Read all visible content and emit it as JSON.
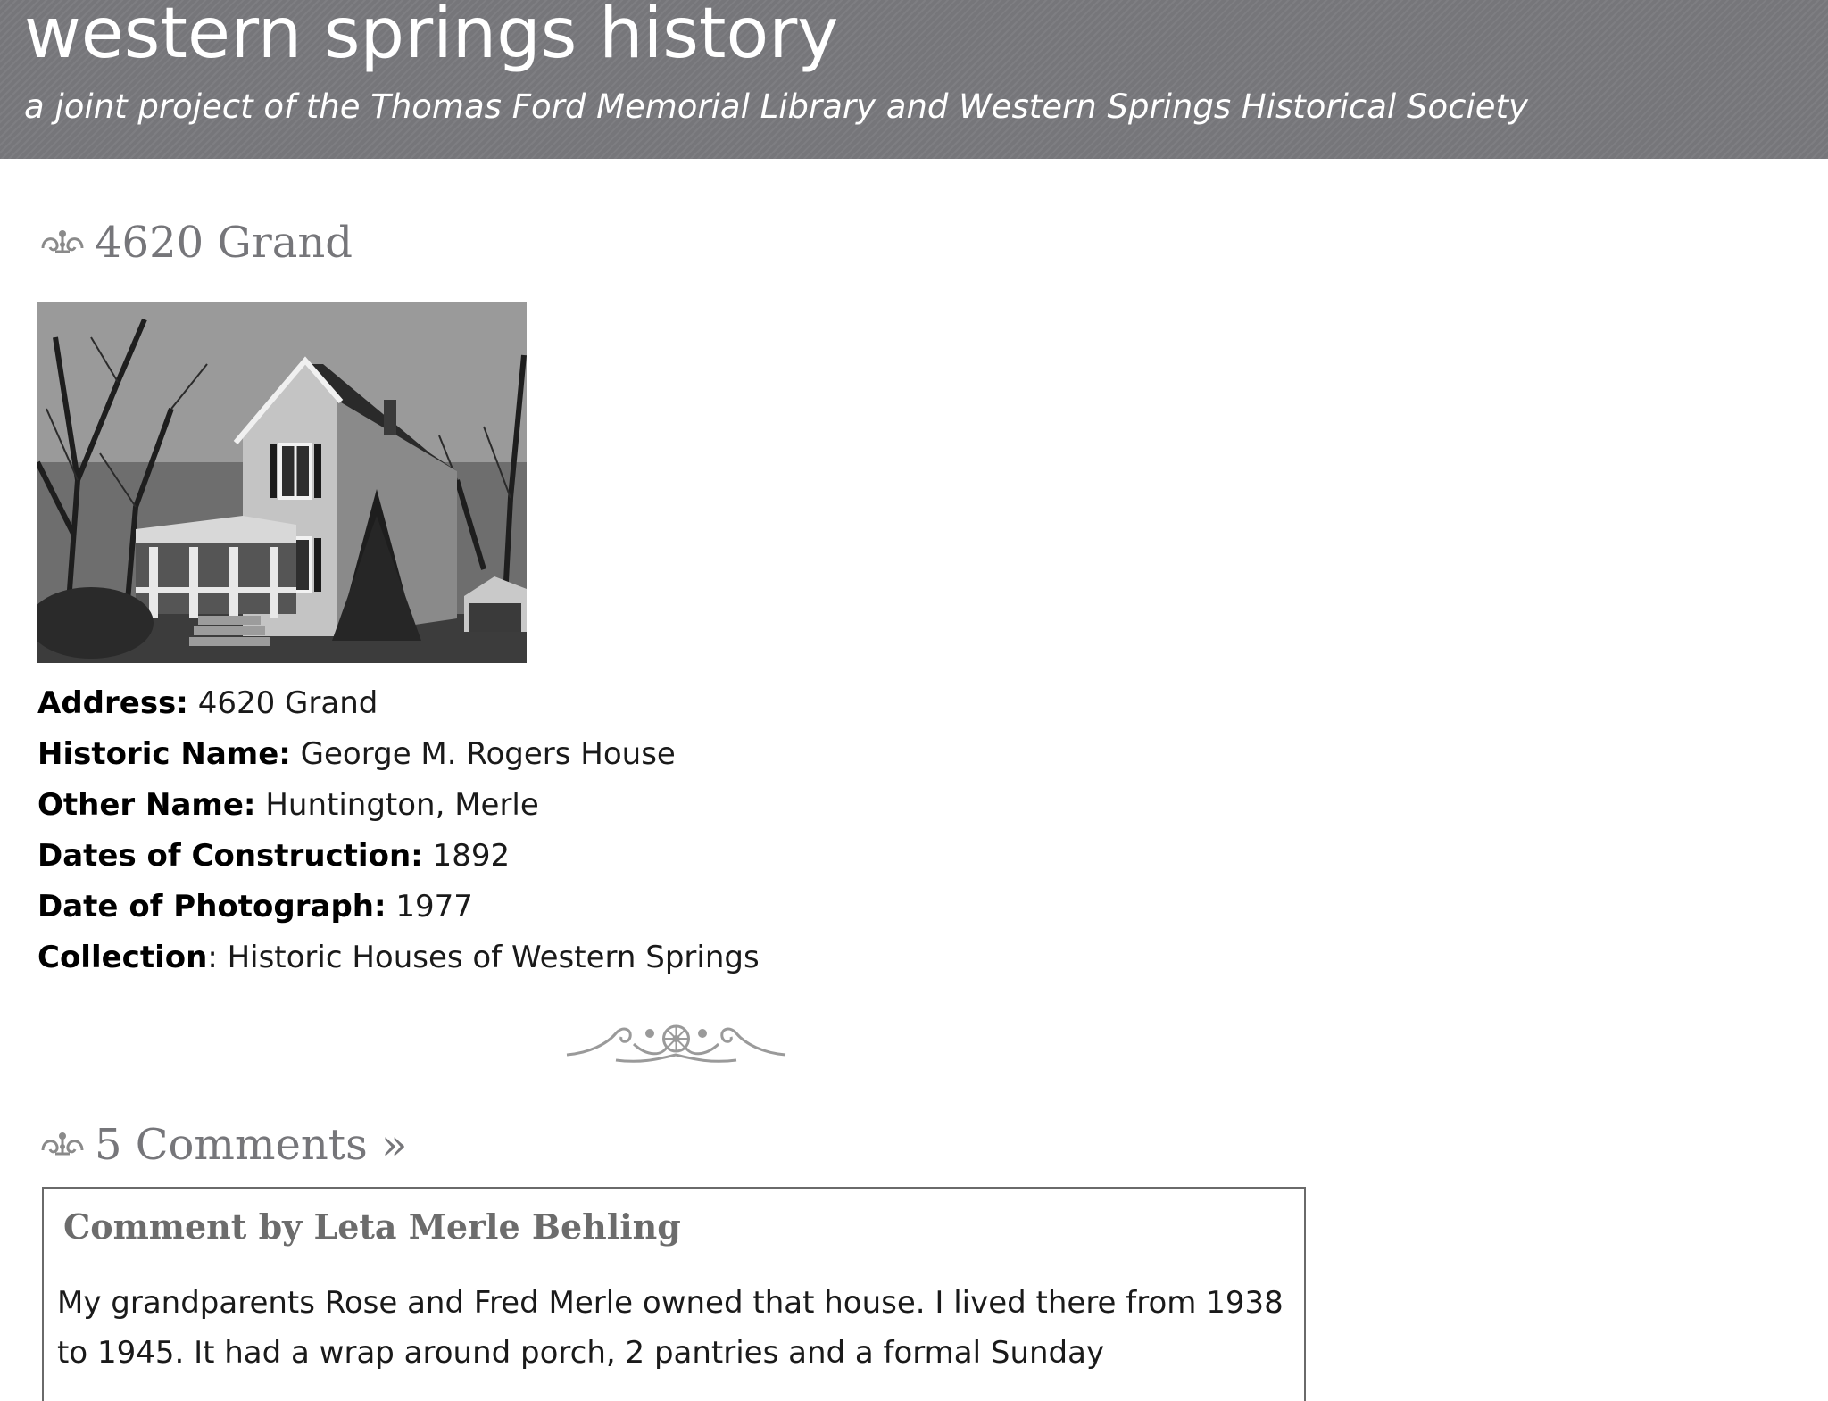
{
  "header": {
    "title": "western springs history",
    "subtitle": "a joint project of the Thomas Ford Memorial Library and Western Springs Historical Society"
  },
  "post": {
    "title": "4620 Grand",
    "image_alt": "Black and white photograph of 4620 Grand",
    "details": [
      {
        "label": "Address:",
        "value": " 4620 Grand"
      },
      {
        "label": "Historic Name:",
        "value": " George M. Rogers House"
      },
      {
        "label": "Other Name:",
        "value": " Huntington, Merle"
      },
      {
        "label": "Dates of Construction:",
        "value": " 1892"
      },
      {
        "label": "Date of Photograph:",
        "value": " 1977"
      },
      {
        "label": "Collection",
        "value": ": Historic Houses of Western Springs"
      }
    ]
  },
  "comments": {
    "heading": "5 Comments »",
    "items": [
      {
        "author": "Comment by Leta Merle Behling",
        "body": "My grandparents Rose and Fred Merle owned that house. I lived there from 1938 to 1945. It had a wrap around porch, 2 pantries and a formal Sunday"
      }
    ]
  },
  "icons": {
    "heading_ornament": "fleuron-icon",
    "divider": "scroll-ornament-icon"
  },
  "colors": {
    "header_bg": "#76767a",
    "heading_text": "#76767a",
    "body_text": "#1a1a1a"
  }
}
